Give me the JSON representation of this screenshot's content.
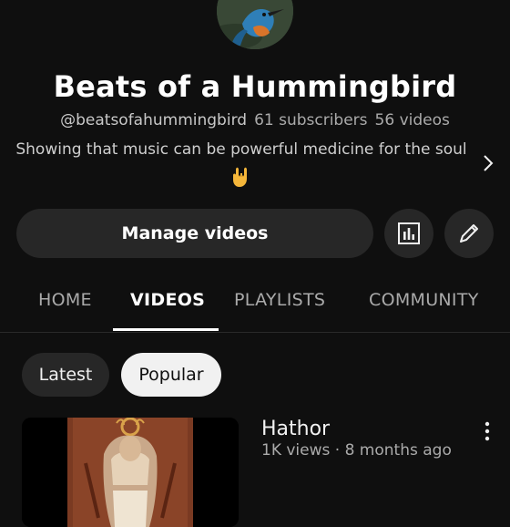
{
  "channel": {
    "title": "Beats of a Hummingbird",
    "handle": "@beatsofahummingbird",
    "subscribers": "61 subscribers",
    "videos_count": "56 videos",
    "description": "Showing that music can be powerful medicine for the soul",
    "description_emoji": "🤟",
    "avatar_icon": "kingfisher-bird-avatar"
  },
  "actions": {
    "manage_label": "Manage videos",
    "analytics_icon": "analytics-icon",
    "edit_icon": "pencil-icon"
  },
  "tabs": [
    {
      "label": "HOME",
      "active": false
    },
    {
      "label": "VIDEOS",
      "active": true
    },
    {
      "label": "PLAYLISTS",
      "active": false
    },
    {
      "label": "COMMUNITY",
      "active": false
    }
  ],
  "filters": [
    {
      "label": "Latest",
      "selected": false
    },
    {
      "label": "Popular",
      "selected": true
    }
  ],
  "videos": [
    {
      "title": "Hathor",
      "meta": "1K views · 8 months ago"
    }
  ],
  "colors": {
    "background": "#0f0f0f",
    "surface": "#272727",
    "text_primary": "#f1f1f1",
    "text_secondary": "#aaaaaa"
  }
}
